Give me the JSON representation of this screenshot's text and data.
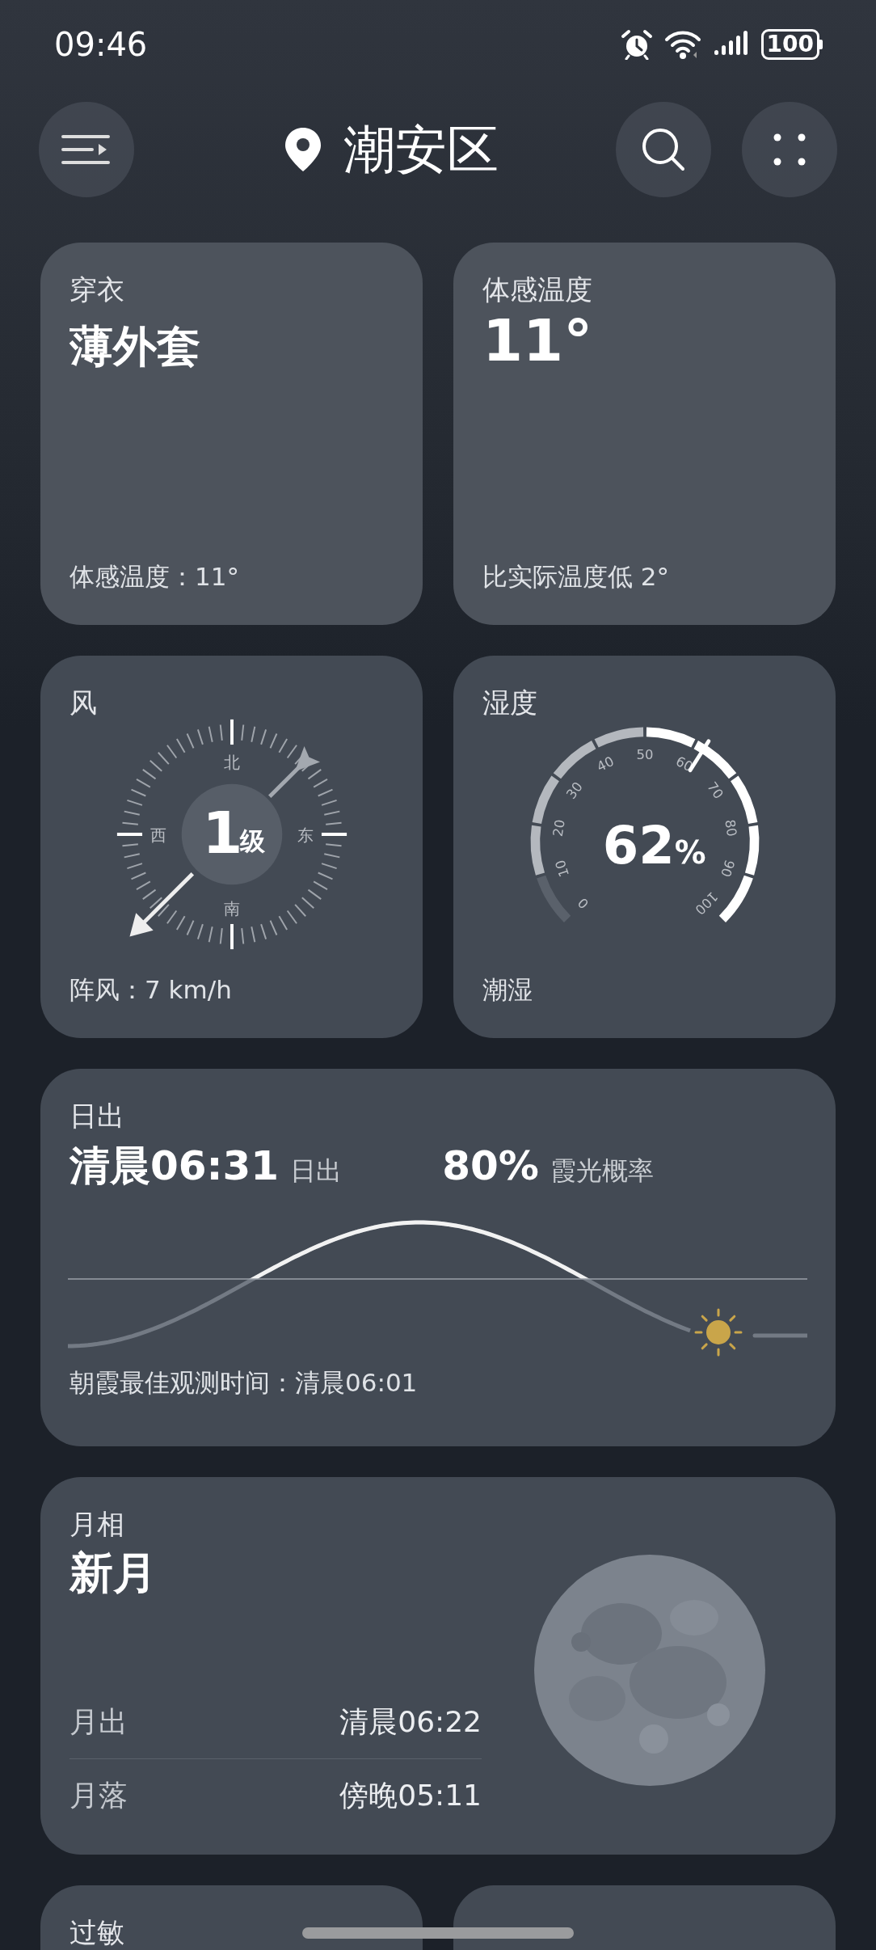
{
  "status_bar": {
    "time": "09:46",
    "battery": "100"
  },
  "header": {
    "location": "潮安区"
  },
  "cards": [
    {
      "kind": "clothing",
      "title": "穿衣",
      "value": "薄外套",
      "footer": "体感温度：11°"
    },
    {
      "kind": "feels_like",
      "title": "体感温度",
      "value": "11°",
      "footer": "比实际温度低 2°"
    },
    {
      "kind": "wind",
      "title": "风",
      "directions": [
        "北",
        "东",
        "南",
        "西"
      ],
      "value": "1",
      "unit": "级",
      "footer": "阵风：7 km/h"
    },
    {
      "kind": "humidity",
      "title": "湿度",
      "scale": [
        "0",
        "10",
        "20",
        "30",
        "40",
        "50",
        "60",
        "70",
        "80",
        "90",
        "100"
      ],
      "value": "62",
      "unit": "%",
      "footer": "潮湿"
    }
  ],
  "sunrise": {
    "title": "日出",
    "time": "清晨06:31",
    "time_label": "日出",
    "probability": "80%",
    "probability_label": "霞光概率",
    "footer": "朝霞最佳观测时间：清晨06:01"
  },
  "moon": {
    "title": "月相",
    "phase": "新月",
    "rows": [
      {
        "label": "月出",
        "value": "清晨06:22"
      },
      {
        "label": "月落",
        "value": "傍晚05:11"
      }
    ]
  },
  "bottom_cards": [
    {
      "title": "过敏"
    }
  ]
}
